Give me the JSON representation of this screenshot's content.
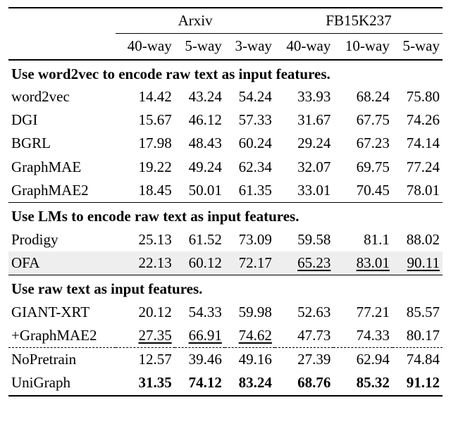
{
  "groups": {
    "g1": "Arxiv",
    "g2": "FB15K237"
  },
  "cols": {
    "a40": "40-way",
    "a5": "5-way",
    "a3": "3-way",
    "f40": "40-way",
    "f10": "10-way",
    "f5": "5-way"
  },
  "sections": {
    "s1": "Use word2vec to encode raw text as input features.",
    "s2": "Use LMs to encode raw text as input features.",
    "s3": "Use raw text as input features."
  },
  "rows": {
    "word2vec": {
      "label": "word2vec",
      "a40": "14.42",
      "a5": "43.24",
      "a3": "54.24",
      "f40": "33.93",
      "f10": "68.24",
      "f5": "75.80"
    },
    "dgi": {
      "label": "DGI",
      "a40": "15.67",
      "a5": "46.12",
      "a3": "57.33",
      "f40": "31.67",
      "f10": "67.75",
      "f5": "74.26"
    },
    "bgrl": {
      "label": "BGRL",
      "a40": "17.98",
      "a5": "48.43",
      "a3": "60.24",
      "f40": "29.24",
      "f10": "67.23",
      "f5": "74.14"
    },
    "graphmae": {
      "label": "GraphMAE",
      "a40": "19.22",
      "a5": "49.24",
      "a3": "62.34",
      "f40": "32.07",
      "f10": "69.75",
      "f5": "77.24"
    },
    "graphmae2": {
      "label": "GraphMAE2",
      "a40": "18.45",
      "a5": "50.01",
      "a3": "61.35",
      "f40": "33.01",
      "f10": "70.45",
      "f5": "78.01"
    },
    "prodigy": {
      "label": "Prodigy",
      "a40": "25.13",
      "a5": "61.52",
      "a3": "73.09",
      "f40": "59.58",
      "f10": "81.1",
      "f5": "88.02"
    },
    "ofa": {
      "label": "OFA",
      "a40": "22.13",
      "a5": "60.12",
      "a3": "72.17",
      "f40": "65.23",
      "f10": "83.01",
      "f5": "90.11"
    },
    "giantxrt": {
      "label": "GIANT-XRT",
      "a40": "20.12",
      "a5": "54.33",
      "a3": "59.98",
      "f40": "52.63",
      "f10": "77.21",
      "f5": "85.57"
    },
    "plusgmae2": {
      "label": "+GraphMAE2",
      "a40": "27.35",
      "a5": "66.91",
      "a3": "74.62",
      "f40": "47.73",
      "f10": "74.33",
      "f5": "80.17"
    },
    "nopretrain": {
      "label": "NoPretrain",
      "a40": "12.57",
      "a5": "39.46",
      "a3": "49.16",
      "f40": "27.39",
      "f10": "62.94",
      "f5": "74.84"
    },
    "unigraph": {
      "label": "UniGraph",
      "a40": "31.35",
      "a5": "74.12",
      "a3": "83.24",
      "f40": "68.76",
      "f10": "85.32",
      "f5": "91.12"
    }
  },
  "chart_data": {
    "type": "table",
    "title": "Few-shot classification results",
    "datasets": [
      {
        "name": "Arxiv",
        "settings": [
          "40-way",
          "5-way",
          "3-way"
        ]
      },
      {
        "name": "FB15K237",
        "settings": [
          "40-way",
          "10-way",
          "5-way"
        ]
      }
    ],
    "sections": [
      {
        "heading": "Use word2vec to encode raw text as input features.",
        "rows": [
          {
            "method": "word2vec",
            "Arxiv": [
              14.42,
              43.24,
              54.24
            ],
            "FB15K237": [
              33.93,
              68.24,
              75.8
            ]
          },
          {
            "method": "DGI",
            "Arxiv": [
              15.67,
              46.12,
              57.33
            ],
            "FB15K237": [
              31.67,
              67.75,
              74.26
            ]
          },
          {
            "method": "BGRL",
            "Arxiv": [
              17.98,
              48.43,
              60.24
            ],
            "FB15K237": [
              29.24,
              67.23,
              74.14
            ]
          },
          {
            "method": "GraphMAE",
            "Arxiv": [
              19.22,
              49.24,
              62.34
            ],
            "FB15K237": [
              32.07,
              69.75,
              77.24
            ]
          },
          {
            "method": "GraphMAE2",
            "Arxiv": [
              18.45,
              50.01,
              61.35
            ],
            "FB15K237": [
              33.01,
              70.45,
              78.01
            ]
          }
        ]
      },
      {
        "heading": "Use LMs to encode raw text as input features.",
        "rows": [
          {
            "method": "Prodigy",
            "Arxiv": [
              25.13,
              61.52,
              73.09
            ],
            "FB15K237": [
              59.58,
              81.1,
              88.02
            ]
          },
          {
            "method": "OFA",
            "Arxiv": [
              22.13,
              60.12,
              72.17
            ],
            "FB15K237": [
              65.23,
              83.01,
              90.11
            ],
            "underline": [
              "FB15K237"
            ]
          }
        ]
      },
      {
        "heading": "Use raw text as input features.",
        "rows": [
          {
            "method": "GIANT-XRT",
            "Arxiv": [
              20.12,
              54.33,
              59.98
            ],
            "FB15K237": [
              52.63,
              77.21,
              85.57
            ]
          },
          {
            "method": "+GraphMAE2",
            "Arxiv": [
              27.35,
              66.91,
              74.62
            ],
            "FB15K237": [
              47.73,
              74.33,
              80.17
            ],
            "underline": [
              "Arxiv"
            ]
          },
          {
            "method": "NoPretrain",
            "Arxiv": [
              12.57,
              39.46,
              49.16
            ],
            "FB15K237": [
              27.39,
              62.94,
              74.84
            ]
          },
          {
            "method": "UniGraph",
            "Arxiv": [
              31.35,
              74.12,
              83.24
            ],
            "FB15K237": [
              68.76,
              85.32,
              91.12
            ],
            "bold": true
          }
        ]
      }
    ]
  }
}
